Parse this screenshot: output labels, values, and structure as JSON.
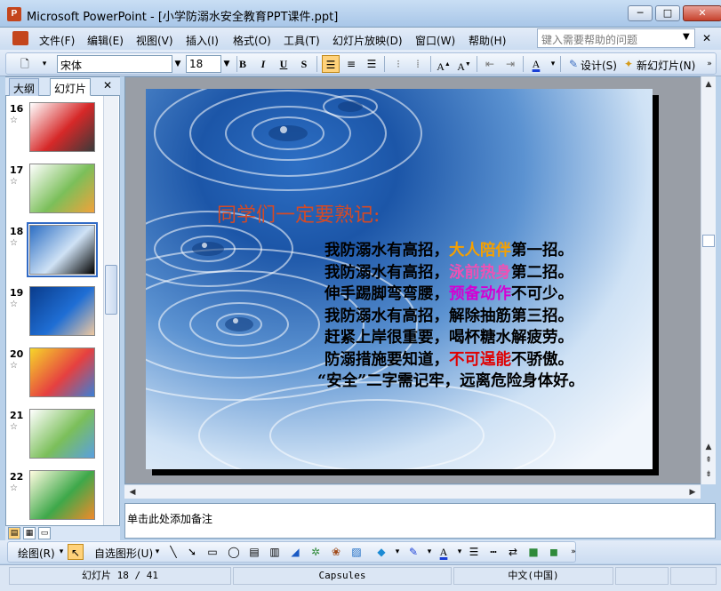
{
  "window": {
    "title": "Microsoft PowerPoint - [小学防溺水安全教育PPT课件.ppt]",
    "app_icon": "P",
    "buttons": [
      "─",
      "□",
      "✕"
    ]
  },
  "menu": {
    "items": [
      "文件(F)",
      "编辑(E)",
      "视图(V)",
      "插入(I)",
      "格式(O)",
      "工具(T)",
      "幻灯片放映(D)",
      "窗口(W)",
      "帮助(H)"
    ],
    "help_placeholder": "键入需要帮助的问题"
  },
  "toolbar": {
    "font_name": "宋体",
    "font_size": "18",
    "bold": "B",
    "italic": "I",
    "underline": "U",
    "shadow": "S",
    "design_label": "设计(S)",
    "new_slide_label": "新幻灯片(N)"
  },
  "left_panel": {
    "tab_outline": "大纲",
    "tab_slides": "幻灯片",
    "close": "✕",
    "thumbnails": [
      {
        "num": "16",
        "selected": false,
        "colors": [
          "#ffffff",
          "#d62828",
          "#3a3a3a"
        ]
      },
      {
        "num": "17",
        "selected": false,
        "colors": [
          "#ffffff",
          "#7bbf5a",
          "#f2a23a"
        ]
      },
      {
        "num": "18",
        "selected": true,
        "colors": [
          "#2d6fc4",
          "#cfe2f5",
          "#000000"
        ]
      },
      {
        "num": "19",
        "selected": false,
        "colors": [
          "#0a3c8c",
          "#1f6ed4",
          "#f0c9a0"
        ]
      },
      {
        "num": "20",
        "selected": false,
        "colors": [
          "#f6d62a",
          "#e64040",
          "#3b7fd6"
        ]
      },
      {
        "num": "21",
        "selected": false,
        "colors": [
          "#ffffff",
          "#7bbf5a",
          "#5aa0e0"
        ]
      },
      {
        "num": "22",
        "selected": false,
        "colors": [
          "#fffbe0",
          "#3ea84a",
          "#f28a2a"
        ]
      }
    ]
  },
  "slide": {
    "heading": "同学们一定要熟记:",
    "lines": [
      [
        {
          "t": "我防溺水有高招，",
          "c": ""
        },
        {
          "t": "大人陪伴",
          "c": "hl-orange"
        },
        {
          "t": "第一招。",
          "c": ""
        }
      ],
      [
        {
          "t": "我防溺水有高招，",
          "c": ""
        },
        {
          "t": "泳前热身",
          "c": "hl-pink"
        },
        {
          "t": "第二招。",
          "c": ""
        }
      ],
      [
        {
          "t": "伸手踢脚弯弯腰，",
          "c": ""
        },
        {
          "t": "预备动作",
          "c": "hl-magenta"
        },
        {
          "t": "不可少。",
          "c": ""
        }
      ],
      [
        {
          "t": "我防溺水有高招，解除抽筋第三招。",
          "c": ""
        }
      ],
      [
        {
          "t": "赶紧上岸很重要，喝杯糖水解疲劳。",
          "c": ""
        }
      ],
      [
        {
          "t": "防溺措施要知道，",
          "c": ""
        },
        {
          "t": "不可逞能",
          "c": "hl-red"
        },
        {
          "t": "不骄傲。",
          "c": ""
        }
      ],
      [
        {
          "t": "“安全”二字需记牢，远离危险身体好。",
          "c": ""
        }
      ]
    ]
  },
  "notes": {
    "placeholder": "单击此处添加备注"
  },
  "drawing_toolbar": {
    "draw_label": "绘图(R)",
    "autoshape_label": "自选图形(U)"
  },
  "status": {
    "slide_indicator": "幻灯片 18 / 41",
    "theme": "Capsules",
    "language": "中文(中国)"
  },
  "icons": [
    "app-icon",
    "new-icon",
    "bold-icon",
    "italic-icon",
    "underline-icon",
    "shadow-icon",
    "align-left-icon",
    "align-center-icon",
    "align-right-icon",
    "numbered-list-icon",
    "bullet-list-icon",
    "grow-font-icon",
    "shrink-font-icon",
    "decrease-indent-icon",
    "increase-indent-icon",
    "font-color-icon",
    "design-icon",
    "new-slide-icon",
    "cursor-icon",
    "line-icon",
    "arrow-icon",
    "rectangle-icon",
    "oval-icon",
    "textbox-icon",
    "vertical-textbox-icon",
    "wordart-icon",
    "diagram-icon",
    "clipart-icon",
    "picture-icon",
    "fill-color-icon",
    "line-color-icon",
    "line-style-icon",
    "dash-style-icon",
    "arrow-style-icon",
    "shadow-style-icon",
    "3d-style-icon"
  ]
}
